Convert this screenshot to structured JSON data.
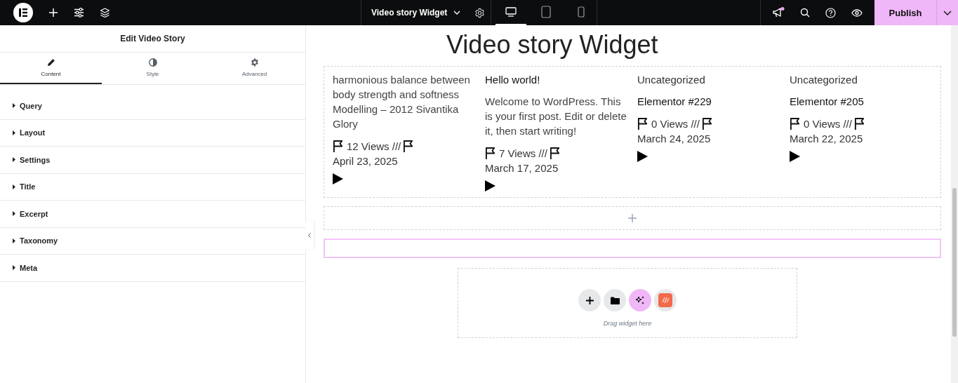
{
  "top_bar": {
    "page_title": "Video story Widget",
    "devices": [
      {
        "kind": "desktop",
        "selected": true
      },
      {
        "kind": "tablet",
        "selected": false
      },
      {
        "kind": "mobile",
        "selected": false
      }
    ],
    "publish": "Publish"
  },
  "panel": {
    "title": "Edit Video Story",
    "tabs": [
      {
        "kind": "content",
        "label": "Content",
        "selected": true
      },
      {
        "kind": "style",
        "label": "Style",
        "selected": false
      },
      {
        "kind": "advanced",
        "label": "Advanced",
        "selected": false
      }
    ],
    "sections": [
      "Query",
      "Layout",
      "Settings",
      "Title",
      "Excerpt",
      "Taxonomy",
      "Meta"
    ]
  },
  "canvas": {
    "heading": "Video story Widget",
    "posts": [
      {
        "excerpt": "harmonious balance between body strength and softness Modelling – 2012 Sivantika Glory",
        "views": "12 Views ///",
        "date": "April 23, 2025"
      },
      {
        "title": "Hello world!",
        "excerpt": "Welcome to WordPress. This is your first post. Edit or delete it, then start writing!",
        "views": "7 Views ///",
        "date": "March 17, 2025"
      },
      {
        "category": "Uncategorized",
        "title": "Elementor #229",
        "views": "0 Views ///",
        "date": "March 24, 2025"
      },
      {
        "category": "Uncategorized",
        "title": "Elementor #205",
        "views": "0 Views ///",
        "date": "March 22, 2025"
      }
    ],
    "drop_zone": {
      "hint": "Drag widget here"
    }
  }
}
